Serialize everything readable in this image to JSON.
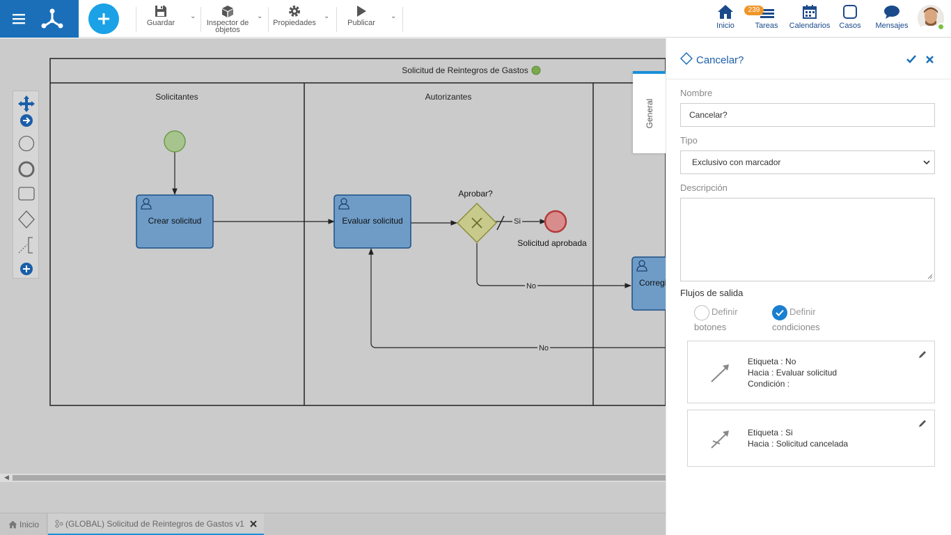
{
  "toolbar": {
    "save_label": "Guardar",
    "inspector_label": "Inspector de objetos",
    "properties_label": "Propiedades",
    "publish_label": "Publicar"
  },
  "nav": {
    "home_label": "Inicio",
    "tasks_label": "Tareas",
    "tasks_badge": "239",
    "calendars_label": "Calendarios",
    "cases_label": "Casos",
    "messages_label": "Mensajes"
  },
  "diagram": {
    "pool_title": "Solicitud de Reintegros de Gastos",
    "lanes": [
      "Solicitantes",
      "Autorizantes"
    ],
    "task_create": "Crear solicitud",
    "task_evaluate": "Evaluar solicitud",
    "task_correct": "Corregi",
    "gateway_label": "Aprobar?",
    "flow_yes": "Si",
    "flow_no": "No",
    "flow_no_2": "No",
    "end_label": "Solicitud aprobada"
  },
  "bottom_tabs": {
    "home": "Inicio",
    "process": "(GLOBAL) Solicitud de Reintegros de Gastos v1"
  },
  "panel": {
    "side_tab": "General",
    "title": "Cancelar?",
    "name_label": "Nombre",
    "name_value": "Cancelar?",
    "type_label": "Tipo",
    "type_value": "Exclusivo con marcador",
    "description_label": "Descripción",
    "description_value": "",
    "outflows_label": "Flujos de salida",
    "option_buttons_line1": "Definir",
    "option_buttons_line2": "botones",
    "option_conditions_line1": "Definir",
    "option_conditions_line2": "condiciones",
    "flows": [
      {
        "label_key": "Etiqueta :",
        "label_val": "No",
        "to_key": "Hacia :",
        "to_val": "Evaluar solicitud",
        "cond_key": "Condición :"
      },
      {
        "label_key": "Etiqueta :",
        "label_val": "Si",
        "to_key": "Hacia :",
        "to_val": "Solicitud cancelada"
      }
    ]
  },
  "colors": {
    "brand": "#1a6fb8",
    "accent": "#1ba1e6",
    "task_fill": "#6e9cc7",
    "gateway_fill": "#c8ca8c",
    "start_fill": "#a7c48e",
    "end_fill": "#d98c8c"
  }
}
